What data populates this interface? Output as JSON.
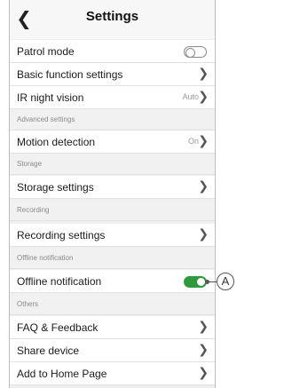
{
  "header": {
    "title": "Settings"
  },
  "rows": {
    "patrol_mode": {
      "label": "Patrol mode"
    },
    "basic_function": {
      "label": "Basic function settings"
    },
    "ir_night_vision": {
      "label": "IR night vision",
      "value": "Auto"
    },
    "advanced_section": {
      "label": "Advanced settings"
    },
    "motion_detection": {
      "label": "Motion detection",
      "value": "On"
    },
    "storage_section": {
      "label": "Storage"
    },
    "storage_settings": {
      "label": "Storage settings"
    },
    "recording_section": {
      "label": "Recording"
    },
    "recording_settings": {
      "label": "Recording settings"
    },
    "offline_section": {
      "label": "Offline notification"
    },
    "offline_notification": {
      "label": "Offline notification"
    },
    "others_section": {
      "label": "Others"
    },
    "faq": {
      "label": "FAQ & Feedback"
    },
    "share_device": {
      "label": "Share device"
    },
    "add_home": {
      "label": "Add to Home Page"
    }
  },
  "toggles": {
    "patrol_mode": false,
    "offline_notification": true
  },
  "callout": {
    "label": "A"
  },
  "colors": {
    "toggle_on": "#2e9a3c",
    "section_bg": "#f1f1f1"
  },
  "icons": {
    "back": "chevron-left-icon",
    "row": "chevron-right-icon"
  }
}
